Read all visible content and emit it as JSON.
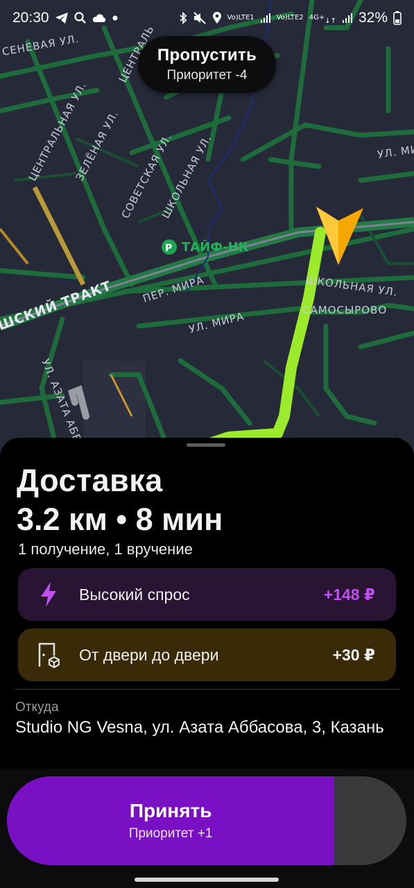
{
  "status_bar": {
    "time": "20:30",
    "lte1": "LTE1",
    "lte2": "LTE2",
    "net": "4G+",
    "battery": "32%"
  },
  "map": {
    "street_labels": [
      "СЕНЕВАЯ УЛ.",
      "ЦЕНТРАЛЬНАЯ УЛ.",
      "ЗЕЛЁНАЯ УЛ.",
      "СОВЕТСКАЯ УЛ.",
      "ШКОЛЬНАЯ УЛ.",
      "ТАЙФ-НК",
      "ШСКИЙ ТРАКТ",
      "ПЕР. МИРА",
      "УЛ. МИРА",
      "УЛ. АЗАТА АББ",
      "ШКОЛЬНАЯ УЛ.",
      "САМОСЫРОВО",
      "УЛ. МИ",
      "ЦЕНТРАЛЬ"
    ],
    "route_color": "#9bea2c",
    "navigator_color": "#f5a800"
  },
  "skip": {
    "title": "Пропустить",
    "subtitle": "Приоритет -4"
  },
  "order": {
    "title": "Доставка",
    "summary": "3.2 км • 8 мин",
    "points": "1 получение, 1 вручение",
    "promos": [
      {
        "icon": "lightning-icon",
        "label": "Высокий спрос",
        "value": "+148 ₽",
        "color": "#c04ff0"
      },
      {
        "icon": "door-package-icon",
        "label": "От двери до двери",
        "value": "+30 ₽",
        "color": "#f0f0f0"
      }
    ],
    "from_label": "Откуда",
    "from_address": "Studio NG Vesna, ул. Азата Аббасова, 3, Казань"
  },
  "accept": {
    "title": "Принять",
    "subtitle": "Приоритет +1",
    "progress": 0.82,
    "color": "#7a10c4"
  }
}
